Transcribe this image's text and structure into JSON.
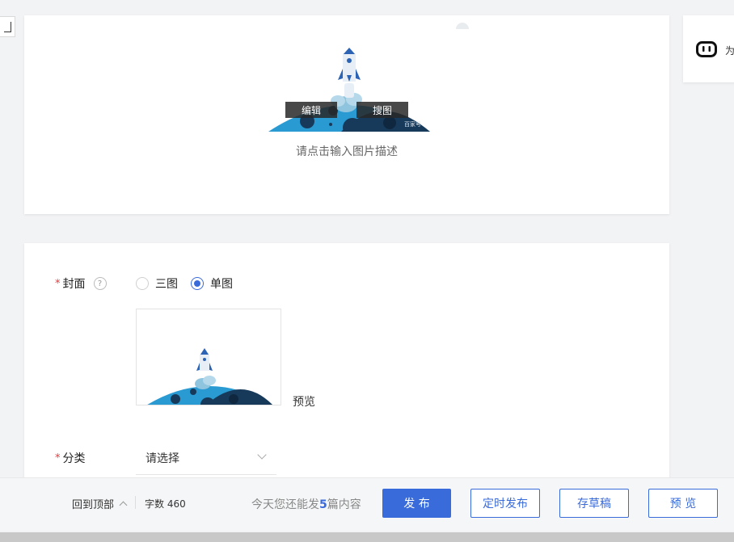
{
  "image_block": {
    "edit_label": "编辑",
    "search_label": "搜图",
    "watermark": "百家号",
    "caption": "请点击输入图片描述"
  },
  "right_widget": {
    "text": "为"
  },
  "cover": {
    "label": "封面",
    "options": [
      "三图",
      "单图"
    ],
    "selected": "单图",
    "preview_label": "预览"
  },
  "category": {
    "label": "分类",
    "value": "请选择"
  },
  "footer": {
    "back_to_top": "回到顶部",
    "word_count": "字数 460",
    "quota_prefix": "今天您还能发",
    "quota_count": "5",
    "quota_suffix": "篇内容",
    "publish": "发 布",
    "scheduled_publish": "定时发布",
    "save_draft": "存草稿",
    "preview": "预 览"
  },
  "colors": {
    "accent": "#3a6bdb",
    "required": "#e4393c",
    "background": "#f2f3f5"
  }
}
